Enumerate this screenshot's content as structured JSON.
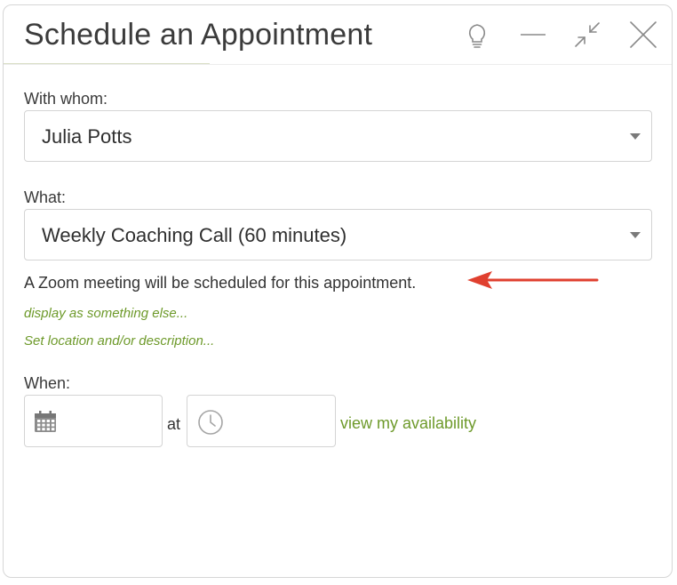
{
  "dialog": {
    "title": "Schedule an Appointment",
    "header_icons": [
      "lightbulb-icon",
      "minimize-icon",
      "collapse-icon",
      "close-icon"
    ]
  },
  "with_whom": {
    "label": "With whom:",
    "value": "Julia Potts"
  },
  "what": {
    "label": "What:",
    "value": "Weekly Coaching Call (60 minutes)"
  },
  "zoom_notice": "A Zoom meeting will be scheduled for this appointment.",
  "links": {
    "display_as": "display as something else...",
    "set_location": "Set location and/or description..."
  },
  "when": {
    "label": "When:",
    "date_value": "",
    "at_label": "at",
    "time_value": "",
    "availability_link": "view my availability"
  },
  "colors": {
    "link_green": "#6e9a2b",
    "arrow_red": "#e0402f",
    "title_text": "#3b3b3b"
  }
}
